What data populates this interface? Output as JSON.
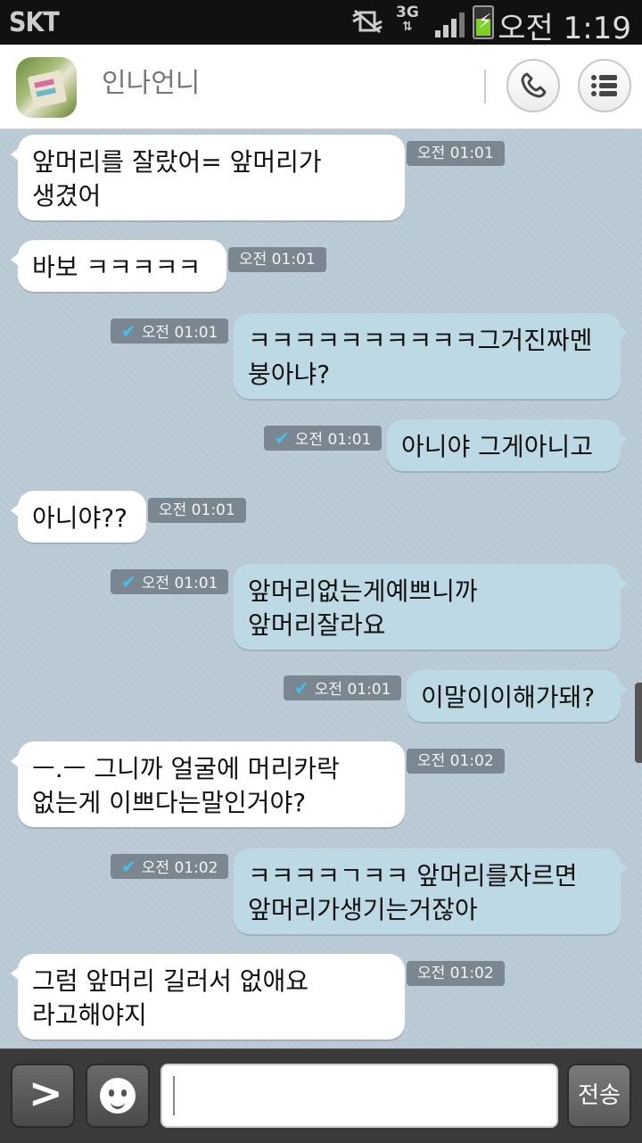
{
  "status_bar": {
    "carrier": "SKT",
    "network": "3G",
    "time": "오전 1:19"
  },
  "header": {
    "chat_name": "인나언니",
    "icons": [
      "phone-icon",
      "menu-list-icon"
    ]
  },
  "messages": [
    {
      "direction": "in",
      "lines": [
        "앞머리를 잘랐어= 앞머리가",
        "생겼어"
      ],
      "time": "오전 01:01",
      "read": false
    },
    {
      "direction": "in",
      "lines": [
        "바보 ㅋㅋㅋㅋㅋ"
      ],
      "time": "오전 01:01",
      "read": false
    },
    {
      "direction": "out",
      "lines": [
        "ㅋㅋㅋㅋㅋㅋㅋㅋㅋㅋ그거진짜멘",
        "붕아냐?"
      ],
      "time": "오전 01:01",
      "read": true
    },
    {
      "direction": "out",
      "lines": [
        "아니야 그게아니고"
      ],
      "time": "오전 01:01",
      "read": true
    },
    {
      "direction": "in",
      "lines": [
        "아니야??"
      ],
      "time": "오전 01:01",
      "read": false
    },
    {
      "direction": "out",
      "lines": [
        "앞머리없는게예쁘니까",
        "앞머리잘라요"
      ],
      "time": "오전 01:01",
      "read": true
    },
    {
      "direction": "out",
      "lines": [
        "이말이이해가돼?"
      ],
      "time": "오전 01:01",
      "read": true
    },
    {
      "direction": "in",
      "lines": [
        "ㅡ.ㅡ 그니까 얼굴에 머리카락",
        "없는게 이쁘다는말인거야?"
      ],
      "time": "오전 01:02",
      "read": false
    },
    {
      "direction": "out",
      "lines": [
        "ㅋㅋㅋㅋㄱㅋㅋ 앞머리를자르면",
        "앞머리가생기는거잖아"
      ],
      "time": "오전 01:02",
      "read": true
    },
    {
      "direction": "in",
      "lines": [
        "그럼 앞머리 길러서 없애요",
        "라고해야지"
      ],
      "time": "오전 01:02",
      "read": false
    }
  ],
  "input_bar": {
    "send_label": "전송",
    "message_value": "",
    "icons": [
      "chevron-right-icon",
      "emoticon-icon"
    ]
  }
}
